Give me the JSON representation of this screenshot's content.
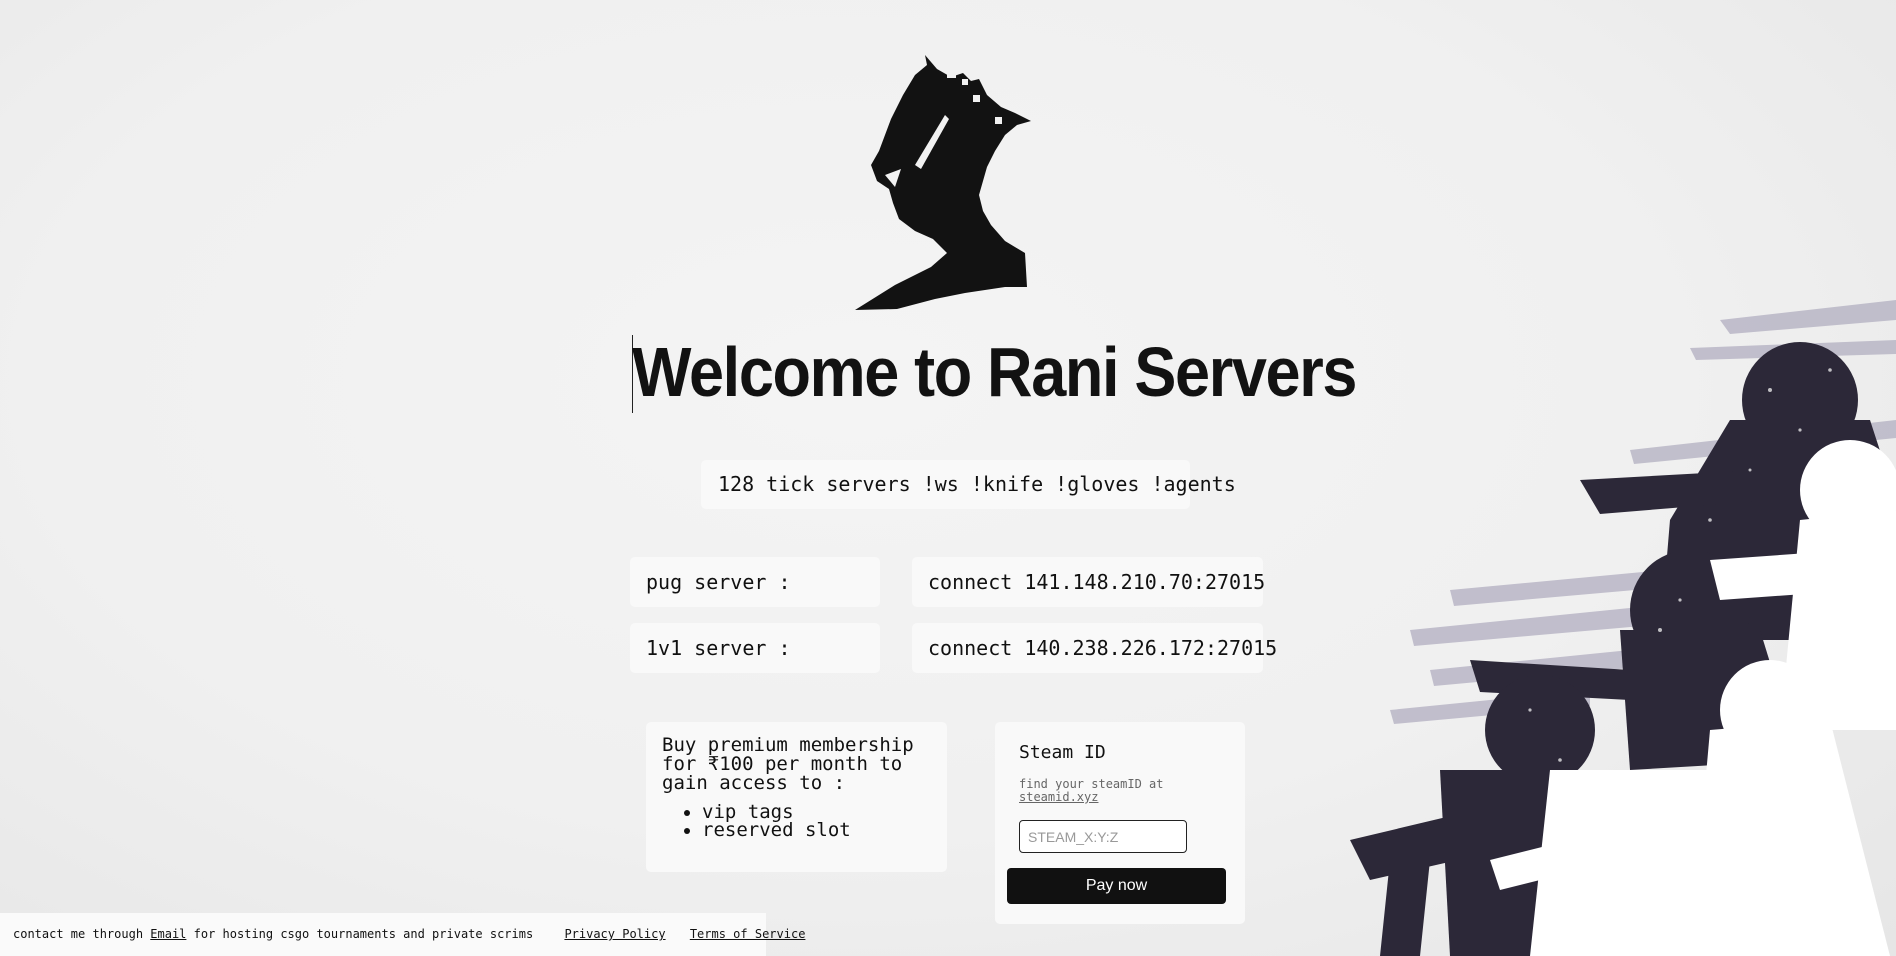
{
  "header": {
    "title": "Welcome to Rani Servers",
    "features": "128 tick servers !ws !knife !gloves !agents"
  },
  "servers": [
    {
      "label": "pug server :",
      "address": "connect 141.148.210.70:27015"
    },
    {
      "label": "1v1 server :",
      "address": "connect 140.238.226.172:27015"
    }
  ],
  "premium": {
    "text": "Buy premium membership for ₹100 per month to gain access to :",
    "perks": [
      "vip tags",
      "reserved slot"
    ]
  },
  "payment": {
    "title": "Steam ID",
    "hint_prefix": "find your steamID at",
    "hint_link": "steamid.xyz",
    "input_placeholder": "STEAM_X:Y:Z",
    "input_value": "",
    "button_label": "Pay now"
  },
  "footer": {
    "prefix": "contact me through",
    "email_link": "Email",
    "suffix": "for hosting csgo tournaments and private scrims",
    "privacy_link": "Privacy Policy",
    "terms_link": "Terms of Service"
  },
  "icons": {
    "logo": "queen-silhouette-logo",
    "art": "soldier-silhouettes-artwork"
  },
  "colors": {
    "background": "#f0f0f0",
    "card": "#f9f9f9",
    "text": "#111111",
    "button": "#111111",
    "art": "#2c2838"
  }
}
